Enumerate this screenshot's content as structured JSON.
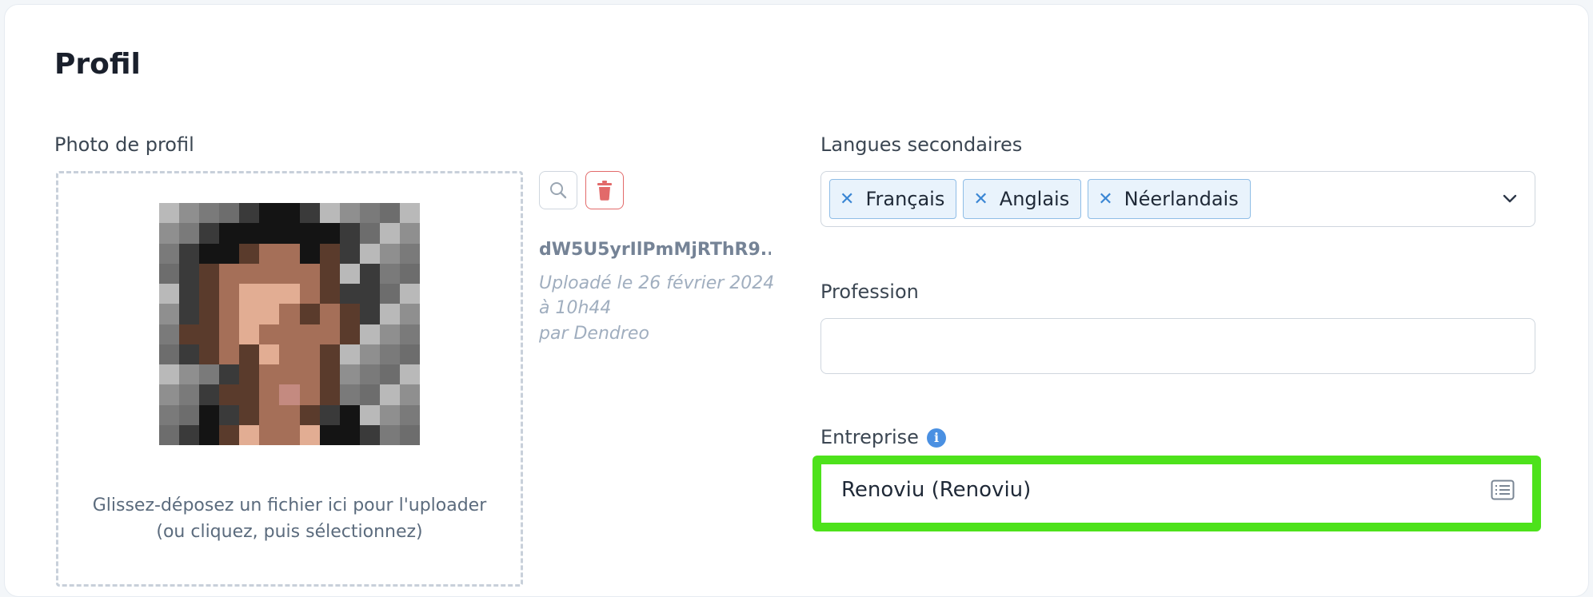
{
  "profile": {
    "title": "Profil",
    "photo": {
      "label": "Photo de profil",
      "drop_hint_line1": "Glissez-déposez un fichier ici pour l'uploader",
      "drop_hint_line2": "(ou cliquez, puis sélectionnez)",
      "filename": "dW5U5yrIlPmMjRThR9...",
      "uploaded_line1": "Uploadé le 26 février 2024",
      "uploaded_line2": "à 10h44",
      "uploaded_by": "par Dendreo",
      "search_icon": "search-icon",
      "delete_icon": "trash-icon"
    },
    "secondary_languages": {
      "label": "Langues secondaires",
      "chips": [
        {
          "label": "Français"
        },
        {
          "label": "Anglais"
        },
        {
          "label": "Néerlandais"
        }
      ]
    },
    "profession": {
      "label": "Profession",
      "value": ""
    },
    "company": {
      "label": "Entreprise",
      "value": "Renoviu (Renoviu)",
      "highlight_color": "#4de21b"
    }
  },
  "colors": {
    "accent": "#4a90e2",
    "danger": "#e26a6a",
    "chip_bg": "#e9f3fc"
  }
}
